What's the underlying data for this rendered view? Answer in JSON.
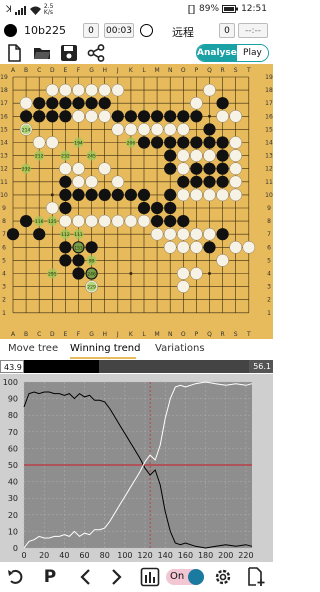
{
  "status": {
    "left_mark": "ꓘ",
    "speed_top": "2.5",
    "speed_bottom": "K/s",
    "battery": "89%",
    "time": "12:51"
  },
  "game": {
    "black_name": "10b225",
    "black_captures": "0",
    "black_time": "00:03",
    "white_name": "远程",
    "white_captures": "0",
    "white_time": "--:--"
  },
  "toolbar": {
    "icons": [
      "new-file-icon",
      "open-folder-icon",
      "save-icon",
      "share-icon"
    ],
    "analyse_label": "Analyse",
    "play_label": "Play"
  },
  "board": {
    "columns": [
      "A",
      "B",
      "C",
      "D",
      "E",
      "F",
      "G",
      "H",
      "J",
      "K",
      "L",
      "M",
      "N",
      "O",
      "P",
      "Q",
      "R",
      "S",
      "T"
    ],
    "rows": [
      "19",
      "18",
      "17",
      "16",
      "15",
      "14",
      "13",
      "12",
      "11",
      "10",
      "9",
      "8",
      "7",
      "6",
      "5",
      "4",
      "3",
      "2",
      "1"
    ],
    "black_stones": [
      "C17",
      "D17",
      "E17",
      "F17",
      "G17",
      "H17",
      "B16",
      "C16",
      "D16",
      "E16",
      "J16",
      "K16",
      "L16",
      "M16",
      "N16",
      "O16",
      "R17",
      "P16",
      "Q15",
      "L14",
      "M14",
      "N14",
      "O14",
      "P14",
      "Q14",
      "R14",
      "N13",
      "Q13",
      "R13",
      "N12",
      "P12",
      "Q12",
      "R12",
      "O11",
      "P11",
      "Q11",
      "R11",
      "E11",
      "E10",
      "F10",
      "G10",
      "H10",
      "J10",
      "K10",
      "L10",
      "N10",
      "E9",
      "L9",
      "M9",
      "N9",
      "B8",
      "M8",
      "N8",
      "O8",
      "A7",
      "C7",
      "R7",
      "Q6",
      "E6",
      "F6",
      "G6",
      "E5",
      "F5",
      "F4",
      "G4"
    ],
    "white_stones": [
      "D18",
      "E18",
      "F18",
      "G18",
      "H18",
      "J18",
      "B17",
      "Q18",
      "P17",
      "R16",
      "S16",
      "F16",
      "G16",
      "H16",
      "J15",
      "K15",
      "L15",
      "M15",
      "N15",
      "O15",
      "B15",
      "C14",
      "D14",
      "P13",
      "Q13a",
      "S14",
      "S13",
      "S12",
      "S11",
      "S10",
      "O12",
      "O13",
      "O10",
      "P10",
      "Q10",
      "R10",
      "E12",
      "F12",
      "F11",
      "G11",
      "J11",
      "H12",
      "E8",
      "F8",
      "G8",
      "H8",
      "J8",
      "K8",
      "L8",
      "D9",
      "M7",
      "N7",
      "O7",
      "P7",
      "Q7",
      "N6",
      "O6",
      "P6",
      "S6",
      "T6",
      "R5",
      "G3",
      "O4",
      "P4",
      "O3"
    ],
    "labels": [
      {
        "pt": "B15",
        "t": "214"
      },
      {
        "pt": "F14",
        "t": "194"
      },
      {
        "pt": "C13",
        "t": "212"
      },
      {
        "pt": "E13",
        "t": "232"
      },
      {
        "pt": "G13",
        "t": "245"
      },
      {
        "pt": "B12",
        "t": "232"
      },
      {
        "pt": "K14",
        "t": "206"
      },
      {
        "pt": "C8",
        "t": "116"
      },
      {
        "pt": "D8",
        "t": "125"
      },
      {
        "pt": "E7",
        "t": "112"
      },
      {
        "pt": "F7",
        "t": "111"
      },
      {
        "pt": "F6",
        "t": "153"
      },
      {
        "pt": "G5",
        "t": "99"
      },
      {
        "pt": "D4",
        "t": "255"
      },
      {
        "pt": "G4",
        "t": "246"
      },
      {
        "pt": "G3",
        "t": "229"
      }
    ]
  },
  "tabs": {
    "move_tree": "Move tree",
    "winning_trend": "Winning trend",
    "variations": "Variations"
  },
  "winrate": {
    "black": "43.9",
    "white": "56.1",
    "black_fraction": 0.439
  },
  "chart_data": {
    "type": "line",
    "y_ticks": [
      "100",
      "90",
      "80",
      "70",
      "60",
      "50",
      "40",
      "30",
      "20",
      "10",
      "0"
    ],
    "x_ticks": [
      "0",
      "20",
      "40",
      "60",
      "80",
      "100",
      "120",
      "140",
      "160",
      "180",
      "200",
      "220"
    ],
    "xlim": [
      0,
      226
    ],
    "ylim": [
      0,
      100
    ],
    "reference_line_y": 50,
    "current_move_x": 125,
    "series": [
      {
        "color": "#000000",
        "x": [
          0,
          5,
          10,
          15,
          20,
          25,
          30,
          35,
          40,
          45,
          50,
          55,
          60,
          65,
          70,
          75,
          80,
          85,
          90,
          95,
          100,
          105,
          110,
          115,
          120,
          125,
          130,
          135,
          140,
          145,
          150,
          155,
          160,
          170,
          180,
          190,
          200,
          210,
          220,
          226
        ],
        "y": [
          85,
          93,
          94,
          93,
          94,
          94,
          93,
          93,
          92,
          93,
          90,
          93,
          91,
          92,
          89,
          89,
          88,
          84,
          79,
          74,
          69,
          64,
          59,
          54,
          48,
          44,
          47,
          38,
          22,
          10,
          3,
          2,
          3,
          1,
          0,
          1,
          2,
          1,
          2,
          1
        ]
      },
      {
        "color": "#ffffff",
        "x": [
          0,
          5,
          10,
          15,
          20,
          25,
          30,
          35,
          40,
          45,
          50,
          55,
          60,
          65,
          70,
          75,
          80,
          85,
          90,
          95,
          100,
          105,
          110,
          115,
          120,
          125,
          130,
          135,
          140,
          145,
          150,
          155,
          160,
          170,
          180,
          190,
          200,
          210,
          220,
          226
        ],
        "y": [
          0,
          4,
          5,
          7,
          6,
          6,
          7,
          7,
          8,
          7,
          10,
          7,
          9,
          8,
          11,
          11,
          12,
          16,
          21,
          26,
          31,
          36,
          41,
          46,
          52,
          56,
          53,
          62,
          78,
          90,
          97,
          98,
          97,
          99,
          100,
          99,
          98,
          99,
          98,
          99
        ]
      }
    ]
  },
  "bottom": {
    "undo_icon": "undo-icon",
    "pass_label": "P",
    "toggle_label": "On"
  }
}
